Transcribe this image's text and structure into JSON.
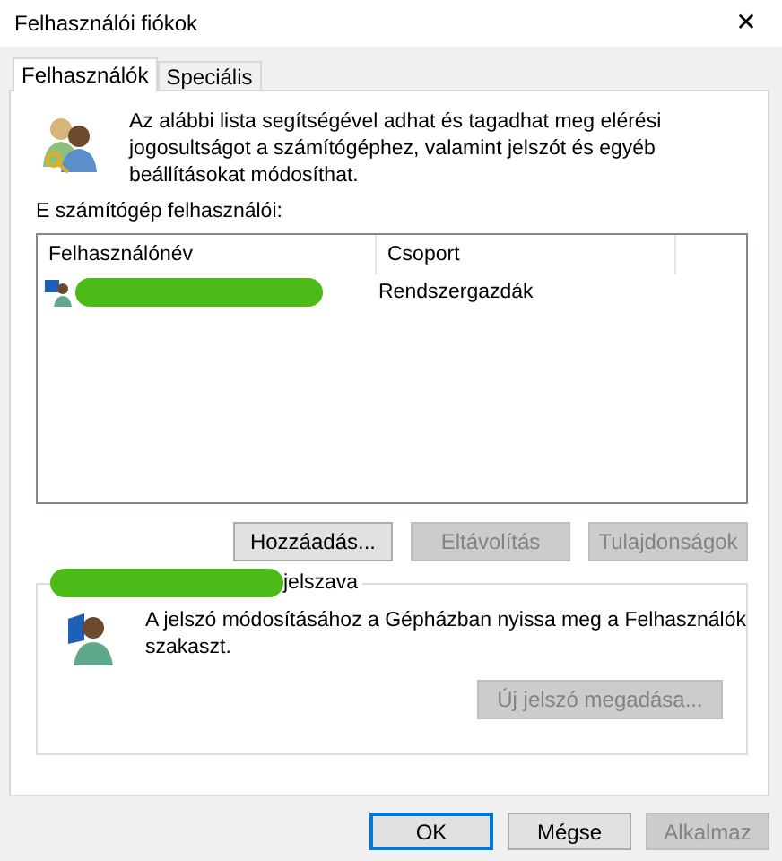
{
  "window": {
    "title": "Felhasználói fiókok",
    "close": "✕"
  },
  "tabs": [
    {
      "label": "Felhasználók",
      "selected": true
    },
    {
      "label": "Speciális",
      "selected": false
    }
  ],
  "intro": "Az alábbi lista segítségével adhat és tagadhat meg elérési jogosultságot a számítógéphez, valamint jelszót és egyéb beállításokat módosíthat.",
  "list_label": "E számítógép felhasználói:",
  "table": {
    "columns": [
      "Felhasználónév",
      "Csoport"
    ],
    "rows": [
      {
        "name_redacted": true,
        "group": "Rendszergazdák"
      }
    ]
  },
  "list_buttons": [
    {
      "label": "Hozzáadás...",
      "disabled": false
    },
    {
      "label": "Eltávolítás",
      "disabled": true
    },
    {
      "label": "Tulajdonságok",
      "disabled": true
    }
  ],
  "password_group": {
    "title_redacted": true,
    "title": "jelszava",
    "text": "A jelszó módosításához a Gépházban nyissa meg a Felhasználók szakaszt.",
    "button": {
      "label": "Új jelszó megadása...",
      "disabled": true
    }
  },
  "buttons": [
    {
      "label": "OK",
      "default": true,
      "disabled": false
    },
    {
      "label": "Mégse",
      "default": false,
      "disabled": false
    },
    {
      "label": "Alkalmaz",
      "default": false,
      "disabled": true
    }
  ]
}
